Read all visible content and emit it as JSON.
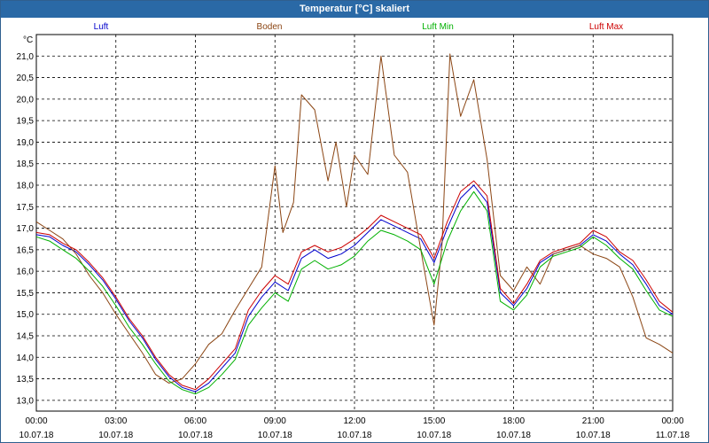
{
  "window": {
    "title": "Temperatur [°C] skaliert"
  },
  "colors": {
    "background": "#ffffff",
    "grid": "#000000",
    "titlebar": "#2a69a6"
  },
  "chart_data": {
    "type": "line",
    "title": "Temperatur [°C] skaliert",
    "ylabel": "°C",
    "xlabel": "",
    "ylim": [
      12.75,
      21.5
    ],
    "xlim": [
      0,
      24
    ],
    "grid": true,
    "legend_position": "top",
    "y_ticks": [
      "13,0",
      "13,5",
      "14,0",
      "14,5",
      "15,0",
      "15,5",
      "16,0",
      "16,5",
      "17,0",
      "17,5",
      "18,0",
      "18,5",
      "19,0",
      "19,5",
      "20,0",
      "20,5",
      "21,0"
    ],
    "x_ticks": [
      {
        "time": "00:00",
        "date": "10.07.18"
      },
      {
        "time": "03:00",
        "date": "10.07.18"
      },
      {
        "time": "06:00",
        "date": "10.07.18"
      },
      {
        "time": "09:00",
        "date": "10.07.18"
      },
      {
        "time": "12:00",
        "date": "10.07.18"
      },
      {
        "time": "15:00",
        "date": "10.07.18"
      },
      {
        "time": "18:00",
        "date": "10.07.18"
      },
      {
        "time": "21:00",
        "date": "10.07.18"
      },
      {
        "time": "00:00",
        "date": "11.07.18"
      }
    ],
    "series": [
      {
        "name": "Luft",
        "color": "#0000cc",
        "points": [
          [
            0,
            16.85
          ],
          [
            0.5,
            16.8
          ],
          [
            1,
            16.6
          ],
          [
            1.5,
            16.45
          ],
          [
            2,
            16.15
          ],
          [
            2.5,
            15.8
          ],
          [
            3,
            15.35
          ],
          [
            3.5,
            14.85
          ],
          [
            4,
            14.45
          ],
          [
            4.5,
            13.95
          ],
          [
            5,
            13.55
          ],
          [
            5.5,
            13.3
          ],
          [
            6,
            13.2
          ],
          [
            6.5,
            13.4
          ],
          [
            7,
            13.75
          ],
          [
            7.5,
            14.1
          ],
          [
            8,
            14.95
          ],
          [
            8.5,
            15.4
          ],
          [
            9,
            15.75
          ],
          [
            9.5,
            15.55
          ],
          [
            10,
            16.3
          ],
          [
            10.5,
            16.5
          ],
          [
            11,
            16.3
          ],
          [
            11.5,
            16.4
          ],
          [
            12,
            16.6
          ],
          [
            12.5,
            16.9
          ],
          [
            13,
            17.2
          ],
          [
            13.5,
            17.05
          ],
          [
            14,
            16.9
          ],
          [
            14.5,
            16.75
          ],
          [
            15,
            16.2
          ],
          [
            15.5,
            17.0
          ],
          [
            16,
            17.7
          ],
          [
            16.5,
            18.0
          ],
          [
            17,
            17.6
          ],
          [
            17.5,
            15.5
          ],
          [
            18,
            15.2
          ],
          [
            18.5,
            15.6
          ],
          [
            19,
            16.2
          ],
          [
            19.5,
            16.4
          ],
          [
            20,
            16.5
          ],
          [
            20.5,
            16.6
          ],
          [
            21,
            16.85
          ],
          [
            21.5,
            16.7
          ],
          [
            22,
            16.4
          ],
          [
            22.5,
            16.15
          ],
          [
            23,
            15.7
          ],
          [
            23.5,
            15.2
          ],
          [
            24,
            15.0
          ]
        ]
      },
      {
        "name": "Boden",
        "color": "#8b4513",
        "points": [
          [
            0,
            17.15
          ],
          [
            0.5,
            16.95
          ],
          [
            1,
            16.75
          ],
          [
            1.5,
            16.4
          ],
          [
            2,
            15.9
          ],
          [
            2.5,
            15.5
          ],
          [
            3,
            15.0
          ],
          [
            3.5,
            14.55
          ],
          [
            4,
            14.1
          ],
          [
            4.5,
            13.6
          ],
          [
            5,
            13.4
          ],
          [
            5.5,
            13.5
          ],
          [
            6,
            13.85
          ],
          [
            6.5,
            14.3
          ],
          [
            7,
            14.55
          ],
          [
            7.5,
            15.1
          ],
          [
            8,
            15.6
          ],
          [
            8.5,
            16.1
          ],
          [
            9,
            18.45
          ],
          [
            9.3,
            16.9
          ],
          [
            9.7,
            17.6
          ],
          [
            10,
            20.1
          ],
          [
            10.5,
            19.75
          ],
          [
            11,
            18.1
          ],
          [
            11.3,
            19.0
          ],
          [
            11.7,
            17.5
          ],
          [
            12,
            18.7
          ],
          [
            12.5,
            18.25
          ],
          [
            13,
            21.0
          ],
          [
            13.5,
            18.7
          ],
          [
            14,
            18.3
          ],
          [
            14.5,
            16.5
          ],
          [
            15,
            14.75
          ],
          [
            15.3,
            16.6
          ],
          [
            15.6,
            21.05
          ],
          [
            16,
            19.6
          ],
          [
            16.5,
            20.45
          ],
          [
            17,
            18.6
          ],
          [
            17.5,
            15.9
          ],
          [
            18,
            15.55
          ],
          [
            18.5,
            16.1
          ],
          [
            19,
            15.7
          ],
          [
            19.5,
            16.4
          ],
          [
            20,
            16.5
          ],
          [
            20.5,
            16.6
          ],
          [
            21,
            16.4
          ],
          [
            21.5,
            16.3
          ],
          [
            22,
            16.1
          ],
          [
            22.5,
            15.4
          ],
          [
            23,
            14.45
          ],
          [
            23.5,
            14.3
          ],
          [
            24,
            14.1
          ]
        ]
      },
      {
        "name": "Luft Min",
        "color": "#00b000",
        "points": [
          [
            0,
            16.8
          ],
          [
            0.5,
            16.7
          ],
          [
            1,
            16.5
          ],
          [
            1.5,
            16.3
          ],
          [
            2,
            16.0
          ],
          [
            2.5,
            15.65
          ],
          [
            3,
            15.2
          ],
          [
            3.5,
            14.7
          ],
          [
            4,
            14.3
          ],
          [
            4.5,
            13.85
          ],
          [
            5,
            13.45
          ],
          [
            5.5,
            13.25
          ],
          [
            6,
            13.15
          ],
          [
            6.5,
            13.3
          ],
          [
            7,
            13.6
          ],
          [
            7.5,
            13.95
          ],
          [
            8,
            14.75
          ],
          [
            8.5,
            15.15
          ],
          [
            9,
            15.5
          ],
          [
            9.5,
            15.3
          ],
          [
            10,
            16.05
          ],
          [
            10.5,
            16.25
          ],
          [
            11,
            16.05
          ],
          [
            11.5,
            16.15
          ],
          [
            12,
            16.35
          ],
          [
            12.5,
            16.7
          ],
          [
            13,
            16.95
          ],
          [
            13.5,
            16.85
          ],
          [
            14,
            16.7
          ],
          [
            14.5,
            16.5
          ],
          [
            15,
            15.7
          ],
          [
            15.5,
            16.7
          ],
          [
            16,
            17.4
          ],
          [
            16.5,
            17.85
          ],
          [
            17,
            17.4
          ],
          [
            17.5,
            15.3
          ],
          [
            18,
            15.1
          ],
          [
            18.5,
            15.45
          ],
          [
            19,
            16.1
          ],
          [
            19.5,
            16.35
          ],
          [
            20,
            16.45
          ],
          [
            20.5,
            16.55
          ],
          [
            21,
            16.8
          ],
          [
            21.5,
            16.6
          ],
          [
            22,
            16.3
          ],
          [
            22.5,
            16.05
          ],
          [
            23,
            15.55
          ],
          [
            23.5,
            15.1
          ],
          [
            24,
            14.95
          ]
        ]
      },
      {
        "name": "Luft Max",
        "color": "#cc0000",
        "points": [
          [
            0,
            16.9
          ],
          [
            0.5,
            16.85
          ],
          [
            1,
            16.65
          ],
          [
            1.5,
            16.5
          ],
          [
            2,
            16.2
          ],
          [
            2.5,
            15.85
          ],
          [
            3,
            15.4
          ],
          [
            3.5,
            14.9
          ],
          [
            4,
            14.5
          ],
          [
            4.5,
            14.0
          ],
          [
            5,
            13.6
          ],
          [
            5.5,
            13.35
          ],
          [
            6,
            13.25
          ],
          [
            6.5,
            13.5
          ],
          [
            7,
            13.85
          ],
          [
            7.5,
            14.2
          ],
          [
            8,
            15.1
          ],
          [
            8.5,
            15.55
          ],
          [
            9,
            15.9
          ],
          [
            9.5,
            15.7
          ],
          [
            10,
            16.45
          ],
          [
            10.5,
            16.6
          ],
          [
            11,
            16.45
          ],
          [
            11.5,
            16.55
          ],
          [
            12,
            16.75
          ],
          [
            12.5,
            17.0
          ],
          [
            13,
            17.3
          ],
          [
            13.5,
            17.15
          ],
          [
            14,
            17.0
          ],
          [
            14.5,
            16.85
          ],
          [
            15,
            16.3
          ],
          [
            15.5,
            17.15
          ],
          [
            16,
            17.85
          ],
          [
            16.5,
            18.1
          ],
          [
            17,
            17.75
          ],
          [
            17.5,
            15.6
          ],
          [
            18,
            15.25
          ],
          [
            18.5,
            15.7
          ],
          [
            19,
            16.25
          ],
          [
            19.5,
            16.45
          ],
          [
            20,
            16.55
          ],
          [
            20.5,
            16.65
          ],
          [
            21,
            16.95
          ],
          [
            21.5,
            16.8
          ],
          [
            22,
            16.45
          ],
          [
            22.5,
            16.25
          ],
          [
            23,
            15.8
          ],
          [
            23.5,
            15.3
          ],
          [
            24,
            15.05
          ]
        ]
      }
    ]
  }
}
